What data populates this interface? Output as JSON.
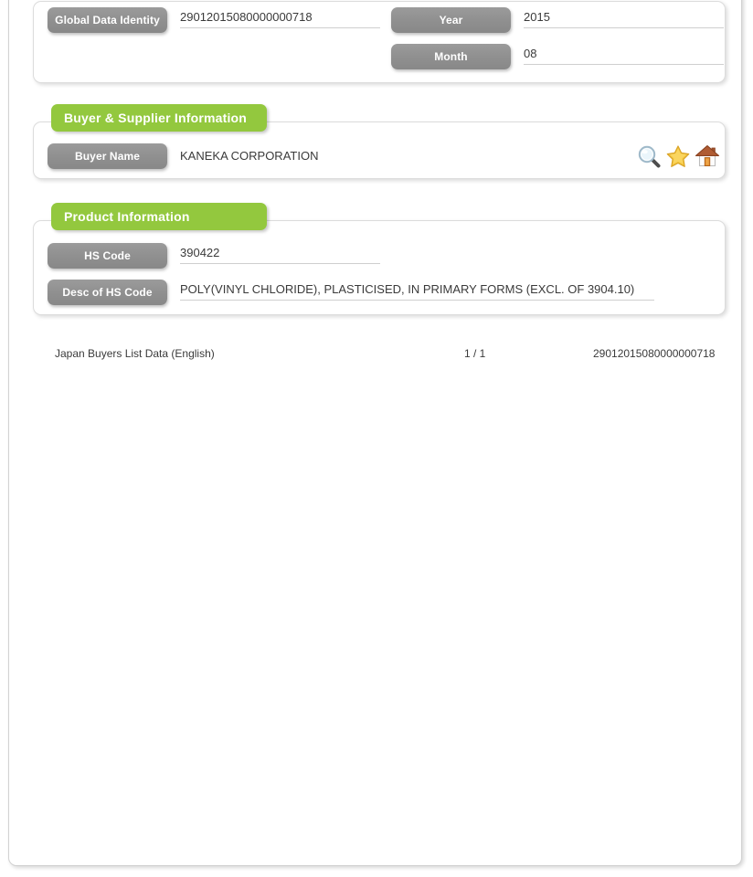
{
  "identity_card": {
    "fields": [
      {
        "label": "Global Data Identity",
        "value": "29012015080000000718"
      },
      {
        "label": "Year",
        "value": "2015"
      },
      {
        "label": "Month",
        "value": "08"
      }
    ]
  },
  "buyer_section": {
    "title": "Buyer & Supplier Information",
    "fields": [
      {
        "label": "Buyer Name",
        "value": "KANEKA CORPORATION"
      }
    ],
    "actions": [
      {
        "name": "search-icon",
        "label": "Search"
      },
      {
        "name": "favorite-icon",
        "label": "Favorite"
      },
      {
        "name": "home-icon",
        "label": "Home"
      }
    ]
  },
  "product_section": {
    "title": "Product Information",
    "fields": [
      {
        "label": "HS Code",
        "value": "390422"
      },
      {
        "label": "Desc of HS Code",
        "value": "POLY(VINYL CHLORIDE), PLASTICISED, IN PRIMARY FORMS (EXCL. OF 3904.10)"
      }
    ]
  },
  "footer": {
    "title": "Japan Buyers List Data (English)",
    "page": "1 / 1",
    "record_id": "29012015080000000718"
  },
  "colors": {
    "section_green": "#93c83e",
    "label_gray": "#909090",
    "text_dark": "#3a3a3a",
    "underline": "#cfcfcf",
    "star_gold": "#f5c842",
    "house_roof": "#a0522d",
    "house_door": "#e08a2e",
    "lens_blue": "#d3e6f2"
  }
}
